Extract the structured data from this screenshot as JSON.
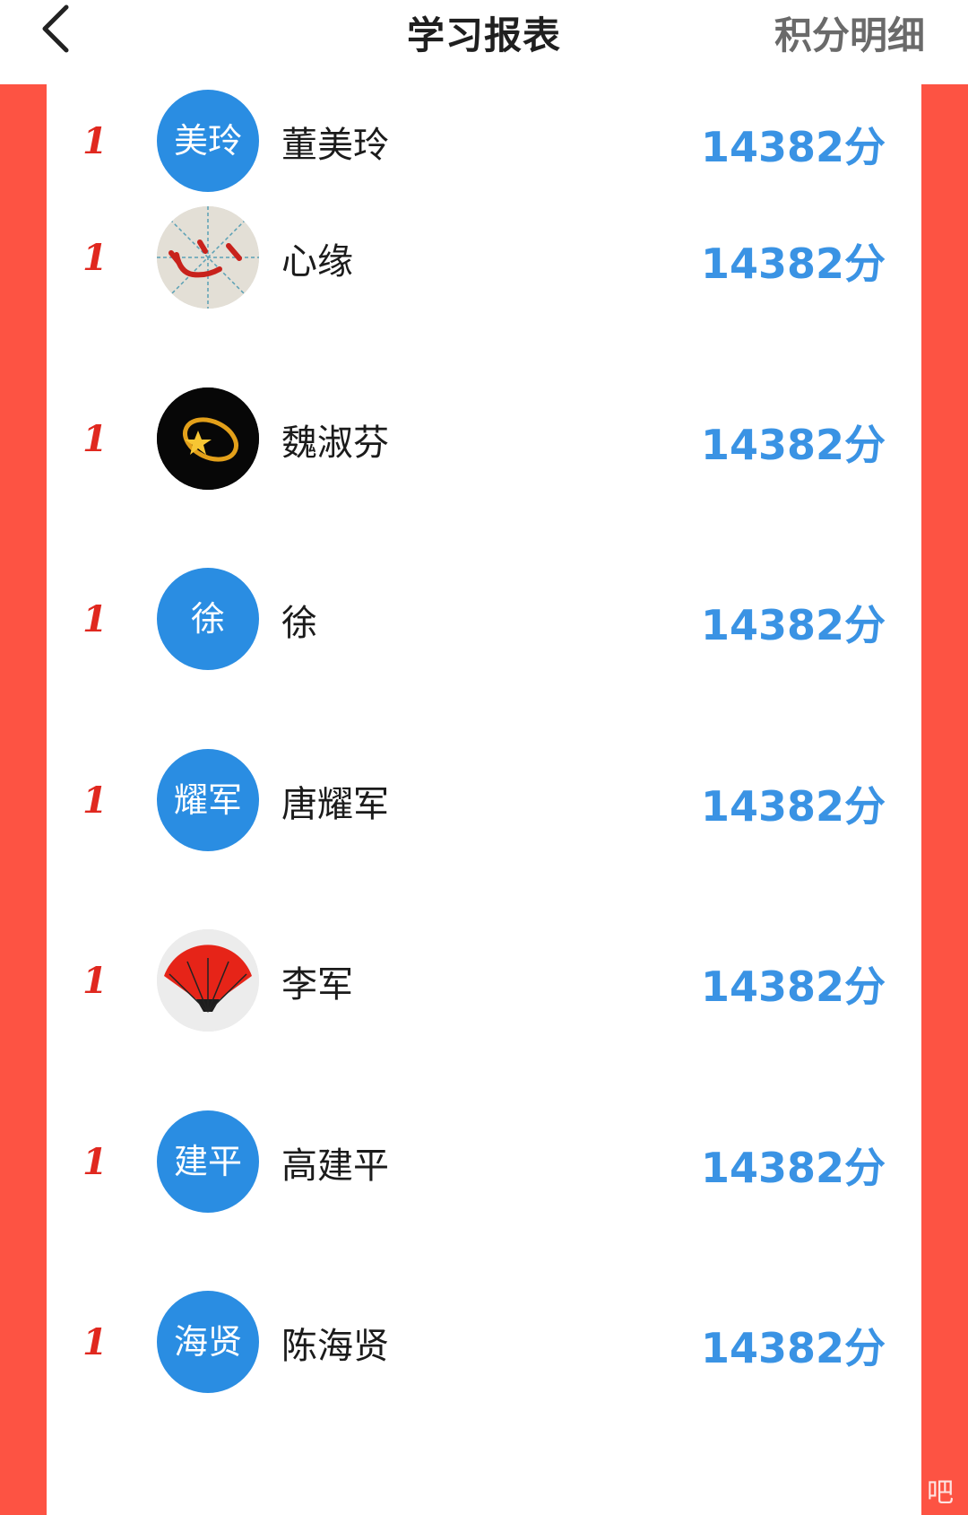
{
  "header": {
    "title": "学习报表",
    "right_link": "积分明细"
  },
  "users": [
    {
      "rank": "1",
      "avatar_text": "美玲",
      "name": "董美玲",
      "score": "14382分",
      "avatar_type": "text"
    },
    {
      "rank": "1",
      "avatar_text": "",
      "name": "心缘",
      "score": "14382分",
      "avatar_type": "calligraphy-image"
    },
    {
      "rank": "1",
      "avatar_text": "",
      "name": "魏淑芬",
      "score": "14382分",
      "avatar_type": "shooting-star-image"
    },
    {
      "rank": "1",
      "avatar_text": "徐",
      "name": "徐",
      "score": "14382分",
      "avatar_type": "text"
    },
    {
      "rank": "1",
      "avatar_text": "耀军",
      "name": "唐耀军",
      "score": "14382分",
      "avatar_type": "text"
    },
    {
      "rank": "1",
      "avatar_text": "",
      "name": "李军",
      "score": "14382分",
      "avatar_type": "red-fan-image"
    },
    {
      "rank": "1",
      "avatar_text": "建平",
      "name": "高建平",
      "score": "14382分",
      "avatar_type": "text"
    },
    {
      "rank": "1",
      "avatar_text": "海贤",
      "name": "陈海贤",
      "score": "14382分",
      "avatar_type": "text"
    }
  ],
  "colors": {
    "accent_blue": "#3a93e4",
    "avatar_blue": "#2a8de2",
    "rank_red": "#e0281f",
    "frame_red": "#fd5343"
  },
  "watermark": "吧"
}
